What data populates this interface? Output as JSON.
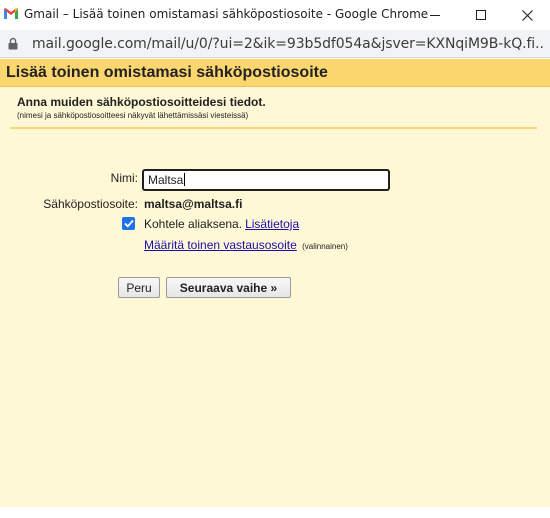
{
  "window": {
    "title": "Gmail – Lisää toinen omistamasi sähköpostiosoite - Google Chrome",
    "url": "mail.google.com/mail/u/0/?ui=2&ik=93b5df054a&jsver=KXNqiM9B-kQ.fi..es5..."
  },
  "dialog": {
    "title": "Lisää toinen omistamasi sähköpostiosoite",
    "instructions_heading": "Anna muiden sähköpostiosoitteidesi tiedot.",
    "instructions_sub": "(nimesi ja sähköpostiosoitteesi näkyvät lähettämissäsi viesteissä)",
    "name_label": "Nimi:",
    "name_value": "Maltsa",
    "email_label": "Sähköpostiosoite:",
    "email_value": "maltsa@maltsa.fi",
    "alias_checked": true,
    "alias_label": "Kohtele aliaksena.",
    "learn_more": "Lisätietoja",
    "reply_to_link": "Määritä toinen vastausosoite",
    "optional_note": "(valinnainen)",
    "cancel_button": "Peru",
    "next_button": "Seuraava vaihe »"
  },
  "colors": {
    "header_bg": "#fcd770",
    "body_bg": "#fff8d6",
    "checkbox_accent": "#1a73e8",
    "link": "#1a0dab"
  },
  "icons": {
    "app": "gmail-icon",
    "security": "lock-icon",
    "minimize": "minimize-icon",
    "maximize": "maximize-icon",
    "close": "close-icon",
    "check": "checkmark-icon"
  }
}
